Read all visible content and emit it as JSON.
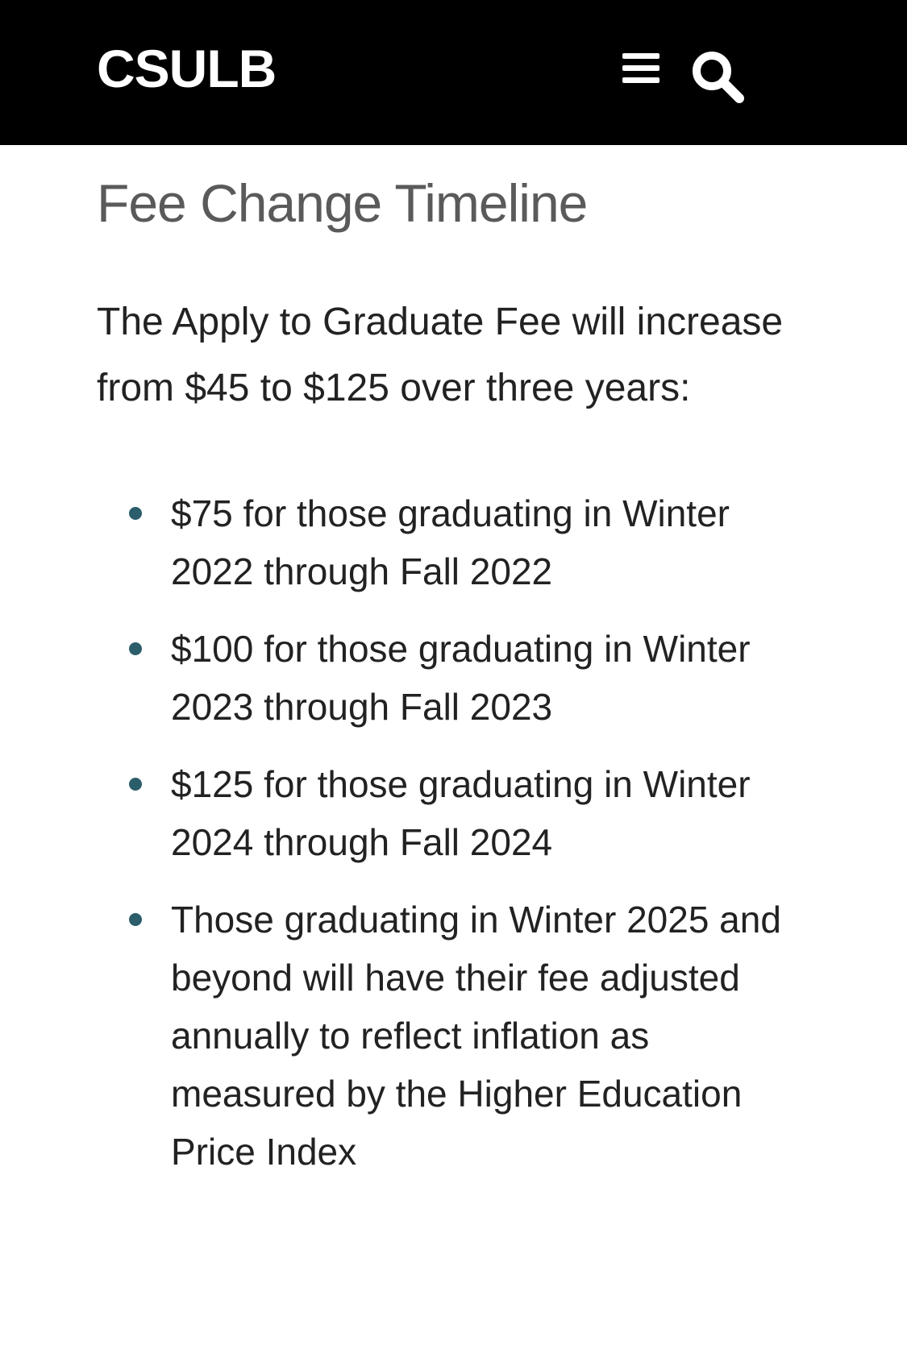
{
  "header": {
    "brand": "CSULB",
    "menu_icon": "hamburger-menu-icon",
    "search_icon": "search-icon",
    "background_color": "#000000",
    "text_color": "#ffffff"
  },
  "main": {
    "title": "Fee Change Timeline",
    "intro": "The Apply to Graduate Fee will increase from $45 to $125 over three years:",
    "items": [
      "$75 for those graduating in Winter 2022 through Fall 2022",
      "$100 for those graduating in Winter 2023 through Fall 2023",
      "$125 for those graduating in Winter 2024 through Fall 2024",
      "Those graduating in Winter 2025 and beyond will have their fee adjusted annually to reflect inflation as measured by the Higher Education Price Index"
    ],
    "bullet_color": "#2b5d6b",
    "title_color": "#5a5a5a"
  }
}
